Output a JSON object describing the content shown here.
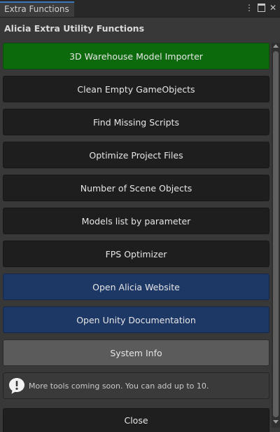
{
  "tab": {
    "title": "Extra Functions"
  },
  "window_controls": {
    "menu_icon": "kebab-menu-icon",
    "maximize_icon": "maximize-icon",
    "close_icon": "close-icon",
    "close_glyph": "✕",
    "menu_glyph": "⋮"
  },
  "header": {
    "title": "Alicia Extra Utility Functions"
  },
  "buttons": [
    {
      "label": "3D Warehouse Model Importer",
      "style": "green"
    },
    {
      "label": "Clean Empty GameObjects",
      "style": "dark"
    },
    {
      "label": "Find Missing Scripts",
      "style": "dark"
    },
    {
      "label": "Optimize Project Files",
      "style": "dark"
    },
    {
      "label": "Number of Scene Objects",
      "style": "dark"
    },
    {
      "label": "Models list by parameter",
      "style": "dark"
    },
    {
      "label": "FPS Optimizer",
      "style": "dark"
    },
    {
      "label": "Open Alicia Website",
      "style": "blue"
    },
    {
      "label": "Open Unity Documentation",
      "style": "blue"
    },
    {
      "label": "System Info",
      "style": "gray"
    }
  ],
  "help_box": {
    "icon": "info-speech-bubble-icon",
    "text": "More tools coming soon. You can add up to 10."
  },
  "close_button": {
    "label": "Close"
  },
  "colors": {
    "green": "#0c6a0c",
    "blue": "#1e3866",
    "gray": "#5b5b5b",
    "dark": "#1e1e1e",
    "tab_accent": "#3a79bb"
  }
}
